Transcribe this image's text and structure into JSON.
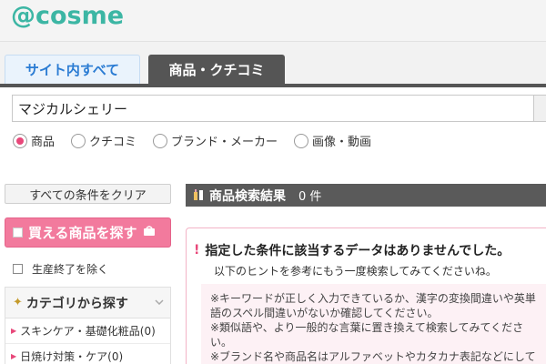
{
  "header": {
    "logo": "@cosme"
  },
  "tabs": [
    {
      "label": "サイト内すべて"
    },
    {
      "label": "商品・クチコミ"
    }
  ],
  "search": {
    "value": "マジカルシェリー",
    "radios": [
      {
        "label": "商品",
        "checked": true
      },
      {
        "label": "クチコミ",
        "checked": false
      },
      {
        "label": "ブランド・メーカー",
        "checked": false
      },
      {
        "label": "画像・動画",
        "checked": false
      }
    ]
  },
  "sidebar": {
    "clear_label": "すべての条件をクリア",
    "buyable_label": "買える商品を探す",
    "discontinued_label": "生産終了を除く",
    "category_title": "カテゴリから探す",
    "categories": [
      {
        "label": "スキンケア・基礎化粧品(0)"
      },
      {
        "label": "日焼け対策・ケア(0)"
      }
    ]
  },
  "results": {
    "title": "商品検索結果",
    "count": "0 件",
    "notice_title": "指定した条件に該当するデータはありませんでした。",
    "notice_sub": "以下のヒントを参考にもう一度検索してみてくださいね。",
    "hints": [
      "※キーワードが正しく入力できているか、漢字の変換間違いや英単語のスペル間違いがないか確認してください。",
      "※類似語や、より一般的な言葉に置き換えて検索してみてください。",
      "※ブランド名や商品名はアルファベットやカタカナ表記などにしてお試ししてみてください。"
    ]
  },
  "colors": {
    "brand": "#3cb6a4",
    "accent_pink": "#f27a9d",
    "tab_active": "#555555",
    "link_blue": "#2b7cd3"
  }
}
